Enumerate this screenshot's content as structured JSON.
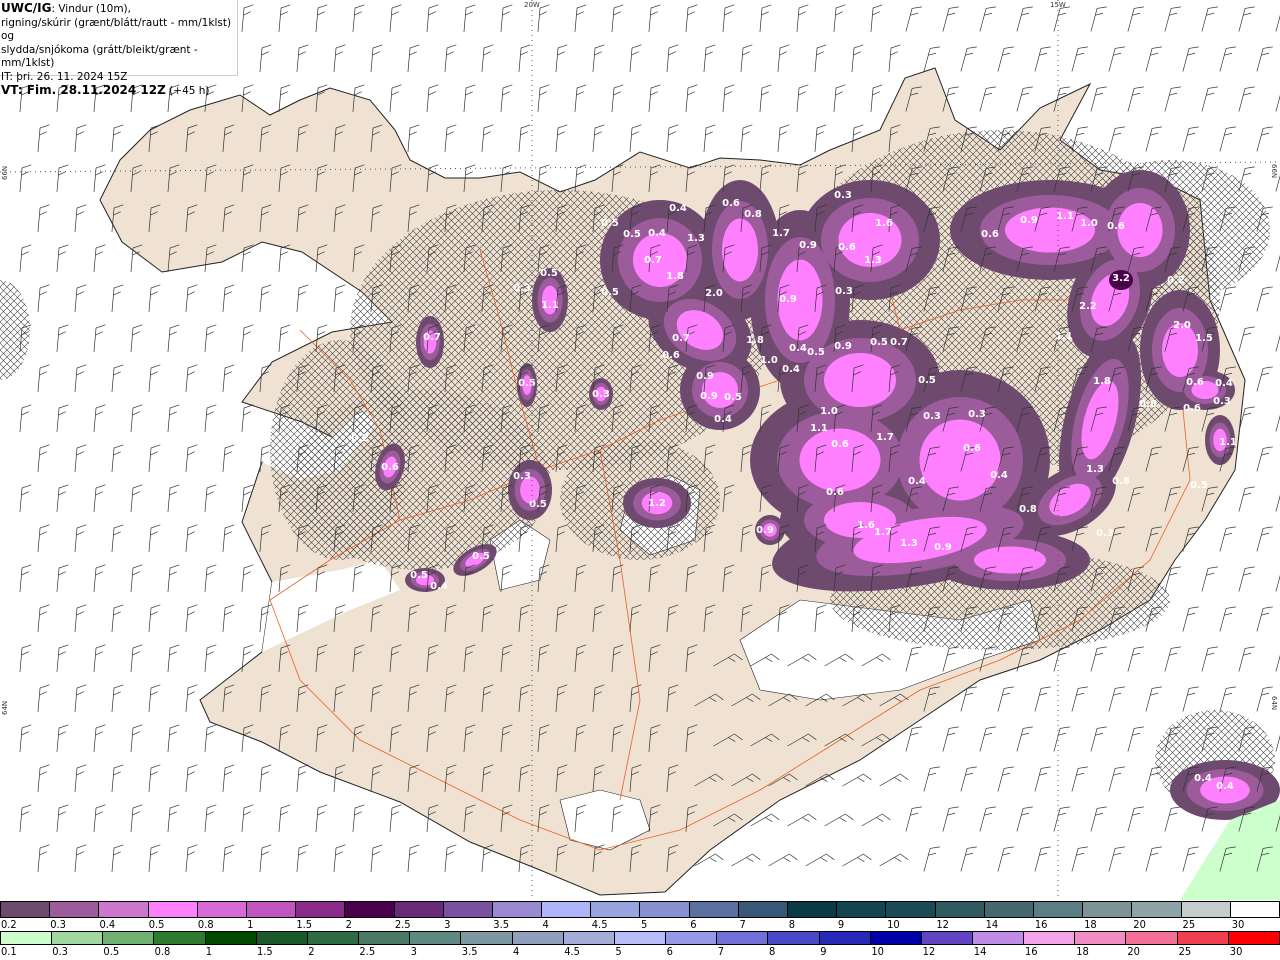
{
  "header": {
    "model": "UWC/IG",
    "line1": ": Vindur (10m),",
    "line2": "rigning/skúrir (grænt/blátt/rautt - mm/1klst) og",
    "line3": "slydda/snjókoma (grátt/bleikt/grænt - mm/1klst)",
    "issue_time": "IT: þri. 26. 11. 2024 15Z",
    "valid_time_bold": "VT: Fim. 28.11.2024 12Z",
    "lead_time": " (+45 h)"
  },
  "map": {
    "graticule_labels": {
      "lon_20": "20W",
      "lon_15": "15W",
      "lat_66_left": "66N",
      "lat_64_left": "64N",
      "lat_66_right": "66N",
      "lat_64_right": "64N"
    },
    "colors": {
      "land": "#f0e2d2",
      "sea": "#ffffff",
      "roads": "#e8602a",
      "snow_dark": "#6e4a6e",
      "snow_mid": "#9c5c9c",
      "snow_light": "#ff80ff",
      "rain_light": "#ccffcc"
    },
    "precip_labels": [
      "0.5",
      "0.5",
      "0.4",
      "0.4",
      "1.3",
      "0.7",
      "1.8",
      "0.5",
      "2.0",
      "0.9",
      "1.7",
      "0.6",
      "0.8",
      "0.9",
      "0.6",
      "1.6",
      "1.3",
      "0.3",
      "0.3",
      "0.7",
      "0.6",
      "1.8",
      "1.0",
      "0.4",
      "0.4",
      "0.5",
      "0.9",
      "0.5",
      "0.7",
      "0.9",
      "0.9",
      "0.5",
      "0.4",
      "0.5",
      "0.3",
      "0.3",
      "1.0",
      "1.1",
      "1.7",
      "0.6",
      "0.4",
      "0.6",
      "0.4",
      "0.6",
      "1.6",
      "1.7",
      "1.3",
      "0.9",
      "0.8",
      "0.6",
      "0.9",
      "1.1",
      "1.0",
      "0.6",
      "3.2",
      "2.2",
      "1.1",
      "0.2",
      "2.0",
      "1.5",
      "1.8",
      "0.6",
      "0.4",
      "0.3",
      "0.6",
      "1.1",
      "0.8",
      "1.3",
      "0.8",
      "0.3",
      "0.5",
      "0.3",
      "0.5",
      "1.1",
      "0.7",
      "0.5",
      "0.3",
      "0.2",
      "0.6",
      "0.3",
      "0.5",
      "1.2",
      "0.5",
      "0.5",
      "0.4",
      "0.4",
      "0.4",
      "0.9"
    ]
  },
  "legend_snow": {
    "labels": [
      "0.2",
      "0.3",
      "0.4",
      "0.5",
      "0.8",
      "1",
      "1.5",
      "2",
      "2.5",
      "3",
      "3.5",
      "4",
      "4.5",
      "5",
      "6",
      "7",
      "8",
      "9",
      "10",
      "12",
      "14",
      "16",
      "18",
      "20",
      "25",
      "30"
    ],
    "colors": [
      "#6e4a6e",
      "#9c5c9c",
      "#cc77cc",
      "#ff80ff",
      "#d86ad8",
      "#c055c0",
      "#8a2a8a",
      "#4a004a",
      "#6a2a7a",
      "#7a50a0",
      "#9a88d0",
      "#b0b4f8",
      "#98a4e0",
      "#8890d0",
      "#5a70a0",
      "#385878",
      "#0a3a48",
      "#124550",
      "#1a4a55",
      "#305a60",
      "#45686e",
      "#5a7e84",
      "#7c9498",
      "#8ea4a8",
      "#c4ccce",
      "#ffffff"
    ]
  },
  "legend_rain": {
    "labels": [
      "0.1",
      "0.3",
      "0.5",
      "0.8",
      "1",
      "1.5",
      "2",
      "2.5",
      "3",
      "3.5",
      "4",
      "4.5",
      "5",
      "6",
      "7",
      "8",
      "9",
      "10",
      "12",
      "14",
      "16",
      "18",
      "20",
      "25",
      "30"
    ],
    "colors": [
      "#ccffcc",
      "#a0d8a0",
      "#70b070",
      "#2e7a2e",
      "#004a00",
      "#1a5a2a",
      "#2e6a44",
      "#4a7a66",
      "#5e8880",
      "#7c98a0",
      "#90a0bc",
      "#a4acd8",
      "#b8bcf8",
      "#9898e8",
      "#7070d8",
      "#4848c8",
      "#2828b8",
      "#0000a8",
      "#6044c4",
      "#c08ce8",
      "#f4a4e8",
      "#f48cc4",
      "#f47098",
      "#f04050",
      "#ff0000"
    ]
  }
}
